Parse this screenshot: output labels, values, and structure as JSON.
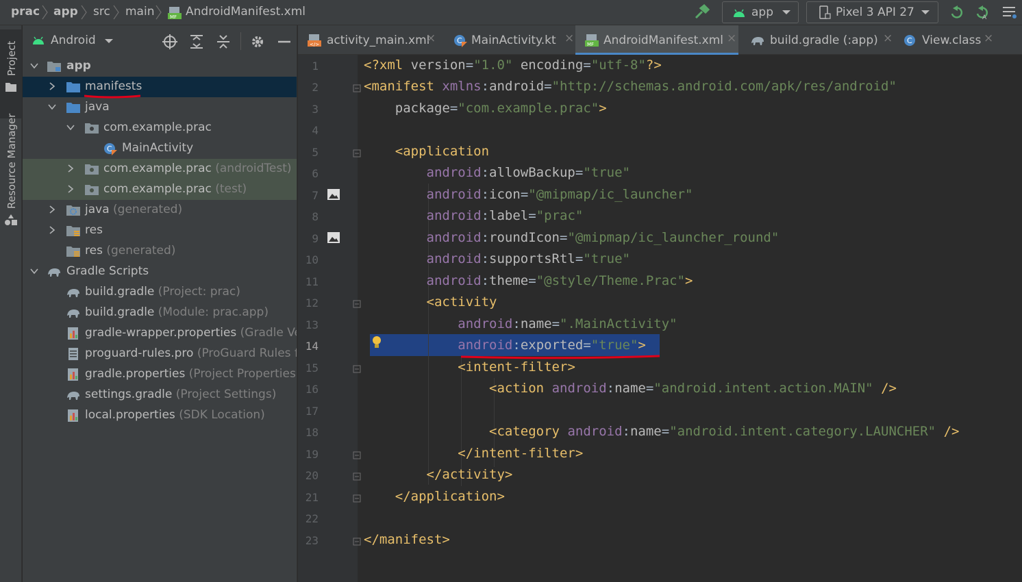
{
  "breadcrumbs": [
    "prac",
    "app",
    "src",
    "main",
    "AndroidManifest.xml"
  ],
  "toolbar": {
    "run_config": "app",
    "device": "Pixel 3 API 27"
  },
  "tool_stripe": {
    "project_label": "Project",
    "resource_manager_label": "Resource Manager"
  },
  "project_panel": {
    "view_mode": "Android",
    "tree": [
      {
        "label": "app",
        "hint": ""
      },
      {
        "label": "manifests",
        "hint": ""
      },
      {
        "label": "java",
        "hint": ""
      },
      {
        "label": "com.example.prac",
        "hint": ""
      },
      {
        "label": "MainActivity",
        "hint": ""
      },
      {
        "label": "com.example.prac",
        "hint": "(androidTest)"
      },
      {
        "label": "com.example.prac",
        "hint": "(test)"
      },
      {
        "label": "java",
        "hint": "(generated)"
      },
      {
        "label": "res",
        "hint": ""
      },
      {
        "label": "res",
        "hint": "(generated)"
      },
      {
        "label": "Gradle Scripts",
        "hint": ""
      },
      {
        "label": "build.gradle",
        "hint": "(Project: prac)"
      },
      {
        "label": "build.gradle",
        "hint": "(Module: prac.app)"
      },
      {
        "label": "gradle-wrapper.properties",
        "hint": "(Gradle Ver"
      },
      {
        "label": "proguard-rules.pro",
        "hint": "(ProGuard Rules fo"
      },
      {
        "label": "gradle.properties",
        "hint": "(Project Properties)"
      },
      {
        "label": "settings.gradle",
        "hint": "(Project Settings)"
      },
      {
        "label": "local.properties",
        "hint": "(SDK Location)"
      }
    ]
  },
  "tabs": [
    {
      "label": "activity_main.xml",
      "active": false
    },
    {
      "label": "MainActivity.kt",
      "active": false
    },
    {
      "label": "AndroidManifest.xml",
      "active": true
    },
    {
      "label": "build.gradle (:app)",
      "active": false
    },
    {
      "label": "View.class",
      "active": false
    }
  ],
  "editor": {
    "current_line": 14,
    "line_numbers": [
      "1",
      "2",
      "3",
      "4",
      "5",
      "6",
      "7",
      "8",
      "9",
      "10",
      "11",
      "12",
      "13",
      "14",
      "15",
      "16",
      "17",
      "18",
      "19",
      "20",
      "21",
      "22",
      "23"
    ],
    "lines": [
      "<?xml version=\"1.0\" encoding=\"utf-8\"?>",
      "<manifest xmlns:android=\"http://schemas.android.com/apk/res/android\"",
      "    package=\"com.example.prac\">",
      "",
      "    <application",
      "        android:allowBackup=\"true\"",
      "        android:icon=\"@mipmap/ic_launcher\"",
      "        android:label=\"prac\"",
      "        android:roundIcon=\"@mipmap/ic_launcher_round\"",
      "        android:supportsRtl=\"true\"",
      "        android:theme=\"@style/Theme.Prac\">",
      "        <activity",
      "            android:name=\".MainActivity\"",
      "            android:exported=\"true\">",
      "            <intent-filter>",
      "                <action android:name=\"android.intent.action.MAIN\" />",
      "",
      "                <category android:name=\"android.intent.category.LAUNCHER\" />",
      "            </intent-filter>",
      "        </activity>",
      "    </application>",
      "",
      "</manifest>"
    ]
  },
  "colors": {
    "annotation_underline": "#e0001a",
    "selection": "#0d293e",
    "current_line": "#214283"
  }
}
